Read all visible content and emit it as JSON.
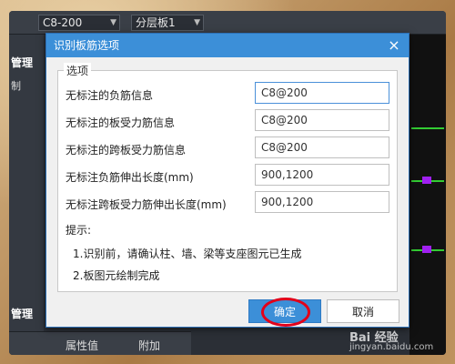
{
  "toolbar": {
    "combo1": "C8-200",
    "combo2": "分层板1"
  },
  "left_panel": {
    "label_top": "管理",
    "label_small": "制",
    "label_bottom": "管理"
  },
  "bottom_bar": {
    "property_value": "属性值",
    "extra": "附加"
  },
  "dialog": {
    "title": "识别板筋选项",
    "close_glyph": "×",
    "group_title": "选项",
    "rows": [
      {
        "label": "无标注的负筋信息",
        "value": "C8@200"
      },
      {
        "label": "无标注的板受力筋信息",
        "value": "C8@200"
      },
      {
        "label": "无标注的跨板受力筋信息",
        "value": "C8@200"
      },
      {
        "label": "无标注负筋伸出长度(mm)",
        "value": "900,1200"
      },
      {
        "label": "无标注跨板受力筋伸出长度(mm)",
        "value": "900,1200"
      }
    ],
    "hint_title": "提示:",
    "hint_1": "1.识别前，请确认柱、墙、梁等支座图元已生成",
    "hint_2": "2.板图元绘制完成",
    "ok_label": "确定",
    "cancel_label": "取消"
  },
  "watermark": {
    "text": "Bai 经验",
    "url": "jingyan.baidu.com"
  },
  "colors": {
    "accent": "#3c8fd8",
    "highlight": "#e2001a"
  }
}
